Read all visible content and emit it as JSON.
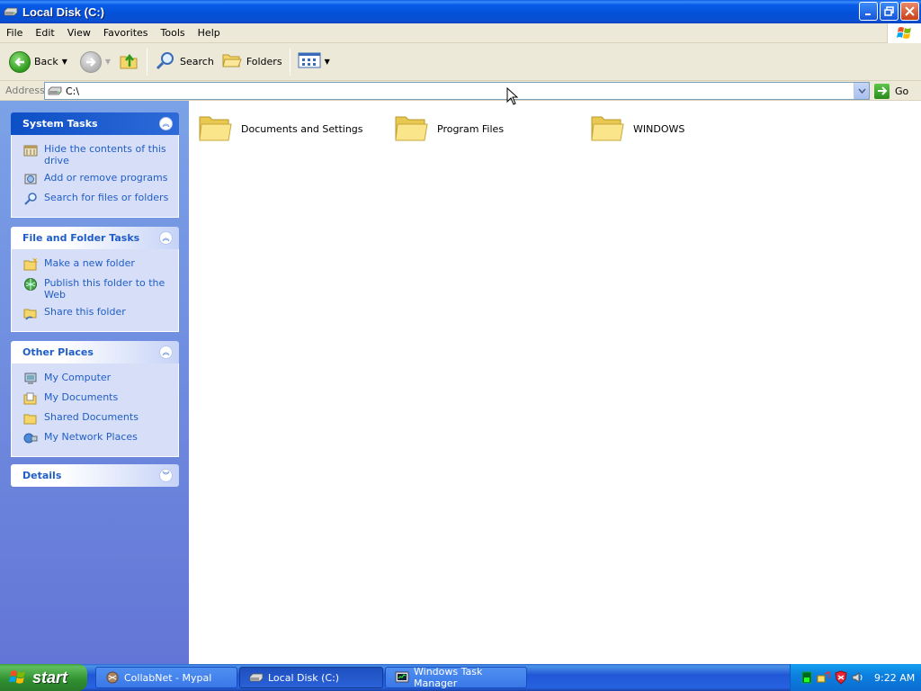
{
  "window": {
    "title": "Local Disk (C:)",
    "icon": "drive-icon"
  },
  "menubar": {
    "items": [
      "File",
      "Edit",
      "View",
      "Favorites",
      "Tools",
      "Help"
    ]
  },
  "toolbar": {
    "back_label": "Back",
    "search_label": "Search",
    "folders_label": "Folders"
  },
  "address": {
    "label": "Address",
    "value": "C:\\",
    "go_label": "Go"
  },
  "left_panel": {
    "system_tasks": {
      "title": "System Tasks",
      "items": [
        {
          "label": "Hide the contents of this drive",
          "icon": "hide-contents-icon"
        },
        {
          "label": "Add or remove programs",
          "icon": "add-remove-programs-icon"
        },
        {
          "label": "Search for files or folders",
          "icon": "search-icon"
        }
      ]
    },
    "file_folder_tasks": {
      "title": "File and Folder Tasks",
      "items": [
        {
          "label": "Make a new folder",
          "icon": "new-folder-icon"
        },
        {
          "label": "Publish this folder to the Web",
          "icon": "publish-web-icon"
        },
        {
          "label": "Share this folder",
          "icon": "share-folder-icon"
        }
      ]
    },
    "other_places": {
      "title": "Other Places",
      "items": [
        {
          "label": "My Computer",
          "icon": "my-computer-icon"
        },
        {
          "label": "My Documents",
          "icon": "my-documents-icon"
        },
        {
          "label": "Shared Documents",
          "icon": "shared-documents-icon"
        },
        {
          "label": "My Network Places",
          "icon": "network-places-icon"
        }
      ]
    },
    "details": {
      "title": "Details"
    }
  },
  "content": {
    "folders": [
      {
        "label": "Documents and Settings"
      },
      {
        "label": "Program Files"
      },
      {
        "label": "WINDOWS"
      }
    ]
  },
  "taskbar": {
    "start_label": "start",
    "buttons": [
      {
        "label": "CollabNet - Mypal",
        "active": false
      },
      {
        "label": "Local Disk (C:)",
        "active": true
      },
      {
        "label": "Windows Task Manager",
        "active": false
      }
    ],
    "clock": "9:22 AM"
  },
  "colors": {
    "title_bar": "#0a5ce8",
    "task_link": "#215dc6",
    "left_panel": "#7ba2e7",
    "taskbar": "#2157d7",
    "start_button": "#3c9f3c"
  }
}
